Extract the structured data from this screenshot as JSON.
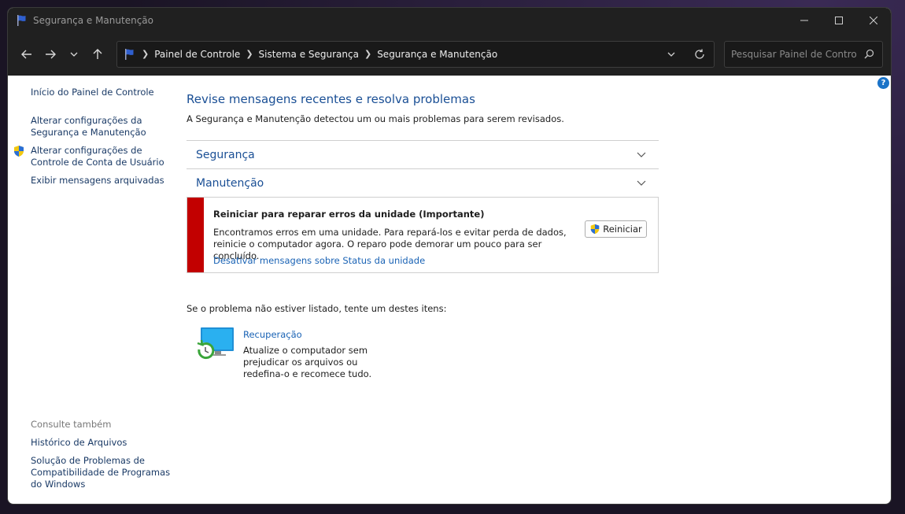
{
  "window": {
    "title": "Segurança e Manutenção"
  },
  "navbar": {
    "breadcrumbs": [
      "Painel de Controle",
      "Sistema e Segurança",
      "Segurança e Manutenção"
    ],
    "search_placeholder": "Pesquisar Painel de Controle"
  },
  "sidebar": {
    "home": "Início do Painel de Controle",
    "item1": "Alterar configurações da Segurança e Manutenção",
    "item2": "Alterar configurações de Controle de Conta de Usuário",
    "item3": "Exibir mensagens arquivadas",
    "see_also_label": "Consulte também",
    "see_also_1": "Histórico de Arquivos",
    "see_also_2": "Solução de Problemas de Compatibilidade de Programas do Windows"
  },
  "main": {
    "heading": "Revise mensagens recentes e resolva problemas",
    "subheading": "A Segurança e Manutenção detectou um ou mais problemas para serem revisados.",
    "sections": [
      "Segurança",
      "Manutenção"
    ],
    "alert": {
      "title": "Reiniciar para reparar erros da unidade  (Importante)",
      "body": "Encontramos erros em uma unidade. Para repará-los e evitar perda de dados, reinicie o computador agora. O reparo pode demorar um pouco para ser concluído.",
      "link": "Desativar mensagens sobre Status da unidade",
      "button": "Reiniciar",
      "color": "#c20000"
    },
    "try_line": "Se o problema não estiver listado, tente um destes itens:",
    "recovery": {
      "link": "Recuperação",
      "description": "Atualize o computador sem prejudicar os arquivos ou redefina-o e recomece tudo."
    }
  }
}
